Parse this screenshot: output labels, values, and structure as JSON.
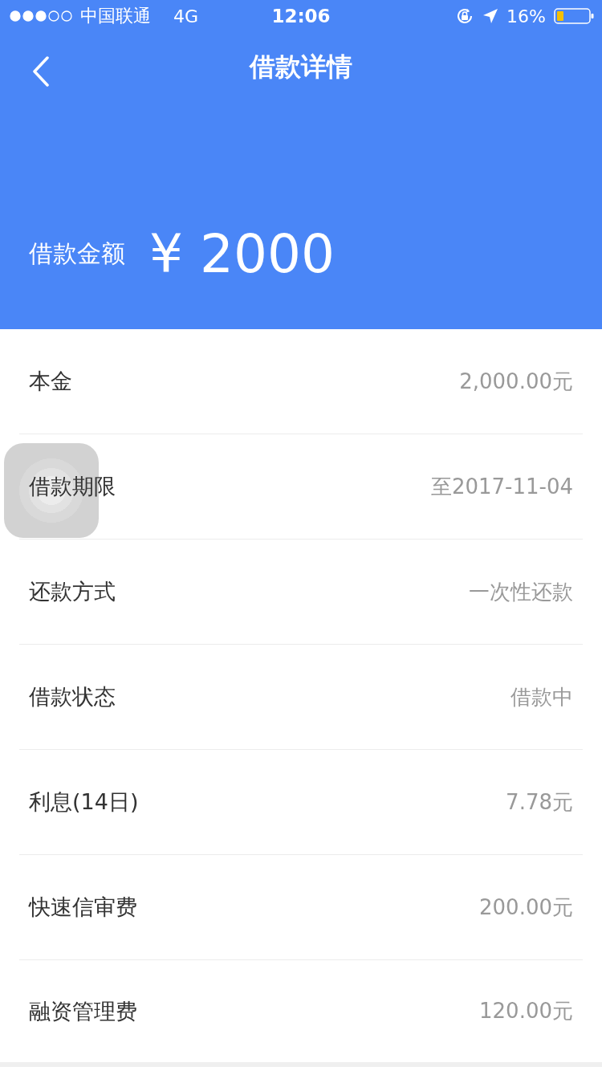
{
  "status_bar": {
    "carrier": "中国联通",
    "network": "4G",
    "time": "12:06",
    "battery": "16%"
  },
  "nav": {
    "title": "借款详情"
  },
  "amount": {
    "label": "借款金额",
    "value": "¥ 2000"
  },
  "details": [
    {
      "label": "本金",
      "value": "2,000.00元"
    },
    {
      "label": "借款期限",
      "value": "至2017-11-04"
    },
    {
      "label": "还款方式",
      "value": "一次性还款"
    },
    {
      "label": "借款状态",
      "value": "借款中"
    },
    {
      "label": "利息(14日)",
      "value": "7.78元"
    },
    {
      "label": "快速信审费",
      "value": "200.00元"
    },
    {
      "label": "融资管理费",
      "value": "120.00元"
    }
  ]
}
